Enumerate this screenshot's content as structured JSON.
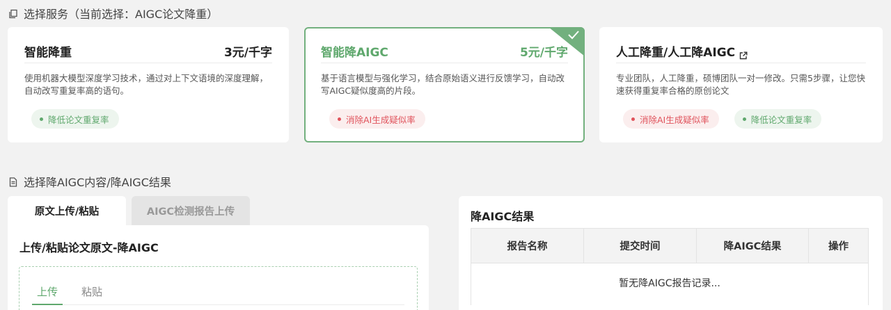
{
  "section1": {
    "icon": "copy-icon",
    "title": "选择服务（当前选择：AIGC论文降重）"
  },
  "services": [
    {
      "name": "智能降重",
      "price": "3元/千字",
      "desc": "使用机器大模型深度学习技术，通过对上下文语境的深度理解，自动改写重复率高的语句。",
      "tags": [
        "降低论文重复率"
      ]
    },
    {
      "name": "智能降AIGC",
      "price": "5元/千字",
      "desc": "基于语言模型与强化学习，结合原始语义进行反馈学习，自动改写AIGC疑似度高的片段。",
      "tags": [
        "消除AI生成疑似率"
      ],
      "selected": true
    },
    {
      "name": "人工降重/人工降AIGC",
      "price": "",
      "desc": "专业团队，人工降重，硕博团队一对一修改。只需5步骤，让您快速获得重复率合格的原创论文",
      "tags": [
        "消除AI生成疑似率",
        "降低论文重复率"
      ]
    }
  ],
  "section2": {
    "icon": "document-icon",
    "title": "选择降AIGC内容/降AIGC结果"
  },
  "tabs": [
    "原文上传/粘贴",
    "AIGC检测报告上传"
  ],
  "upload": {
    "title": "上传/粘贴论文原文-降AIGC",
    "sub_tabs": [
      "上传",
      "粘贴"
    ]
  },
  "result": {
    "title": "降AIGC结果",
    "columns": [
      "报告名称",
      "提交时间",
      "降AIGC结果",
      "操作"
    ],
    "empty_text": "暂无降AIGC报告记录..."
  },
  "colors": {
    "accent": "#5fa86d",
    "selected_border": "#72b07e",
    "red_tag": "#e0525b"
  }
}
